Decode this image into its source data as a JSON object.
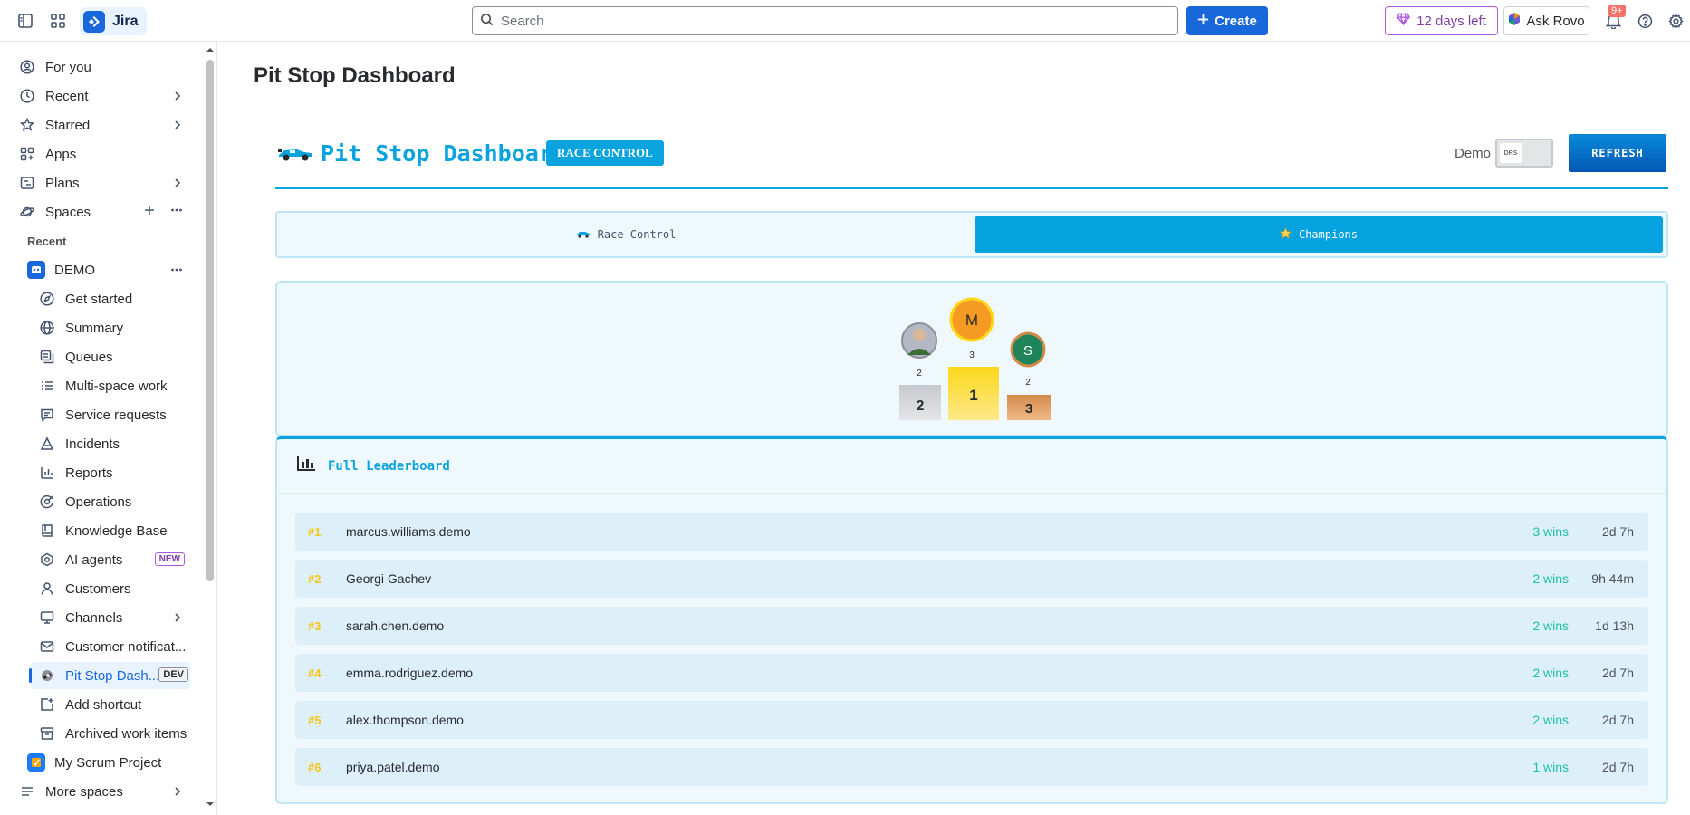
{
  "topbar": {
    "product": "Jira",
    "search_placeholder": "Search",
    "create_label": "Create",
    "trial_label": "12 days left",
    "rovo_label": "Ask Rovo",
    "notif_count": "9+"
  },
  "sidebar": {
    "top_items": [
      {
        "label": "For you",
        "icon": "person-circle-icon"
      },
      {
        "label": "Recent",
        "icon": "clock-icon"
      },
      {
        "label": "Starred",
        "icon": "star-icon"
      },
      {
        "label": "Apps",
        "icon": "apps-icon"
      },
      {
        "label": "Plans",
        "icon": "plans-icon"
      },
      {
        "label": "Spaces",
        "icon": "planet-icon"
      }
    ],
    "recent_label": "Recent",
    "demo_space": "DEMO",
    "demo_items": [
      {
        "label": "Get started",
        "icon": "compass-icon"
      },
      {
        "label": "Summary",
        "icon": "globe-icon"
      },
      {
        "label": "Queues",
        "icon": "queues-icon"
      },
      {
        "label": "Multi-space work",
        "icon": "list-icon"
      },
      {
        "label": "Service requests",
        "icon": "chat-icon"
      },
      {
        "label": "Incidents",
        "icon": "warning-icon"
      },
      {
        "label": "Reports",
        "icon": "chart-icon"
      },
      {
        "label": "Operations",
        "icon": "operations-icon"
      },
      {
        "label": "Knowledge Base",
        "icon": "book-icon"
      },
      {
        "label": "AI agents",
        "icon": "ai-agent-icon",
        "badge": "NEW"
      },
      {
        "label": "Customers",
        "icon": "person-icon"
      },
      {
        "label": "Channels",
        "icon": "monitor-icon"
      },
      {
        "label": "Customer notificat...",
        "icon": "mail-icon"
      },
      {
        "label": "Pit Stop Dash...",
        "icon": "app-icon",
        "badge": "DEV"
      },
      {
        "label": "Add shortcut",
        "icon": "add-shortcut-icon"
      },
      {
        "label": "Archived work items",
        "icon": "archive-icon"
      }
    ],
    "scrum_project": "My Scrum Project",
    "more_spaces": "More spaces"
  },
  "main": {
    "page_title": "Pit Stop Dashboard",
    "app_title": "Pit Stop Dashboard",
    "race_control_badge": "RACE CONTROL",
    "demo_label": "Demo",
    "toggle_knob": "DRS",
    "refresh_label": "REFRESH",
    "tabs": [
      {
        "label": "Race Control",
        "icon": "car-icon",
        "active": false
      },
      {
        "label": "Champions",
        "icon": "star-icon",
        "active": true
      }
    ]
  },
  "podium": {
    "first": {
      "initial": "M",
      "wins": "3",
      "place": "1",
      "color": "#f59a23"
    },
    "second": {
      "initial": "",
      "wins": "2",
      "place": "2",
      "color": "#8c8f97"
    },
    "third": {
      "initial": "S",
      "wins": "2",
      "place": "3",
      "color": "#1f845a"
    }
  },
  "leaderboard": {
    "title": "Full Leaderboard",
    "rows": [
      {
        "rank": "#1",
        "name": "marcus.williams.demo",
        "wins": "3 wins",
        "time": "2d 7h"
      },
      {
        "rank": "#2",
        "name": "Georgi Gachev",
        "wins": "2 wins",
        "time": "9h 44m"
      },
      {
        "rank": "#3",
        "name": "sarah.chen.demo",
        "wins": "2 wins",
        "time": "1d 13h"
      },
      {
        "rank": "#4",
        "name": "emma.rodriguez.demo",
        "wins": "2 wins",
        "time": "2d 7h"
      },
      {
        "rank": "#5",
        "name": "alex.thompson.demo",
        "wins": "2 wins",
        "time": "2d 7h"
      },
      {
        "rank": "#6",
        "name": "priya.patel.demo",
        "wins": "1 wins",
        "time": "2d 7h"
      }
    ]
  }
}
